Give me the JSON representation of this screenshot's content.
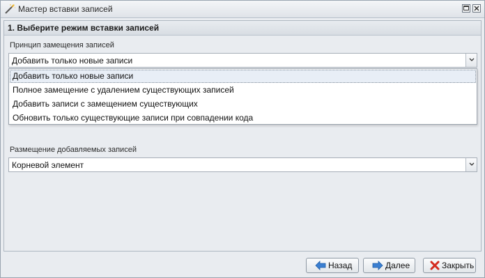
{
  "window": {
    "title": "Мастер вставки записей"
  },
  "panel": {
    "header": "1. Выберите режим вставки записей"
  },
  "replace_mode": {
    "label": "Принцип замещения записей",
    "value": "Добавить только новые записи",
    "options": [
      "Добавить только новые записи",
      "Полное замещение с удалением существующих записей",
      "Добавить записи с замещением существующих",
      "Обновить только существующие записи при совпадении кода"
    ],
    "selected_index": 0
  },
  "placement": {
    "label": "Размещение добавляемых записей",
    "value": "Корневой элемент"
  },
  "footer": {
    "back_label": "Назад",
    "next_label": "Далее",
    "close_label": "Закрыть"
  },
  "colors": {
    "back_icon": "#3b7fd1",
    "next_icon": "#3b7fd1",
    "close_icon": "#d42a1e"
  }
}
